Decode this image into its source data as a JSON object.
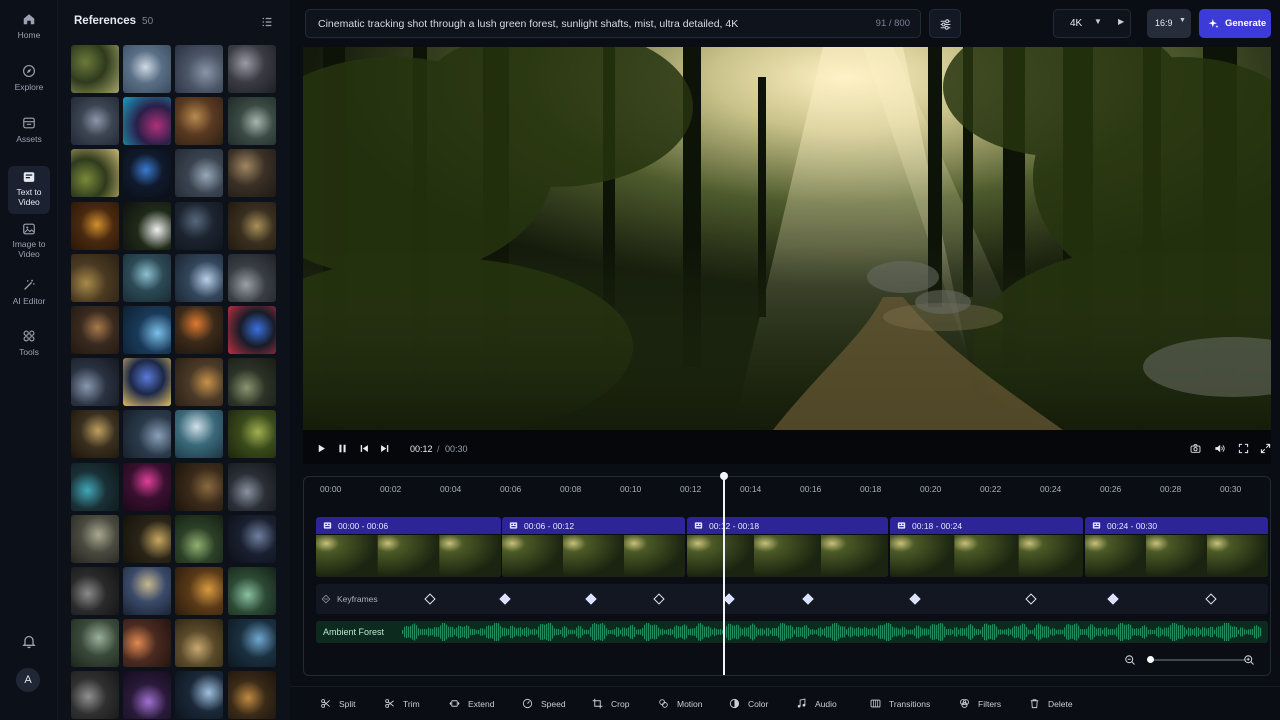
{
  "nav": {
    "items": [
      {
        "label": "Home",
        "icon": "home-icon"
      },
      {
        "label": "Explore",
        "icon": "compass-icon"
      },
      {
        "label": "Assets",
        "icon": "folder-icon"
      },
      {
        "label": "Text to\nVideo",
        "icon": "text-video-icon",
        "active": true
      },
      {
        "label": "Image to\nVideo",
        "icon": "image-video-icon"
      },
      {
        "label": "AI Editor",
        "icon": "magic-wand-icon"
      },
      {
        "label": "Tools",
        "icon": "grid-icon"
      }
    ],
    "bell_icon": "bell-icon",
    "avatar_initial": "A"
  },
  "references": {
    "title": "References",
    "count": "50",
    "list_icon": "list-icon",
    "thumbnail_rows": 13,
    "thumbnail_columns": 4
  },
  "prompt": {
    "text": "Cinematic tracking shot through a lush green forest, sunlight shafts, mist, ultra detailed, 4K",
    "counter": "91 / 800"
  },
  "toolbar_top": {
    "adjust_icon": "sliders-icon",
    "resolution": "4K",
    "aspect_ratio": "16:9",
    "generate_label": "Generate",
    "generate_icon": "sparkle-icon",
    "accent_color": "#3d3bd8"
  },
  "player": {
    "current_time": "00:12",
    "separator": "/",
    "total_time": "00:30",
    "icons": [
      "play-icon",
      "pause-icon",
      "skip-back-icon",
      "skip-forward-icon",
      "camera-icon",
      "volume-icon",
      "fullscreen-icon",
      "expand-icon"
    ]
  },
  "timeline": {
    "ticks": [
      "00:00",
      "00:02",
      "00:04",
      "00:06",
      "00:08",
      "00:10",
      "00:12",
      "00:14",
      "00:16",
      "00:18",
      "00:20",
      "00:22",
      "00:24",
      "00:26",
      "00:28",
      "00:30"
    ],
    "playhead_time": "00:12",
    "clips": [
      {
        "label": "00:00  -  00:06"
      },
      {
        "label": "00:06  -  00:12"
      },
      {
        "label": "00:12  -  00:18"
      },
      {
        "label": "00:18  -  00:24"
      },
      {
        "label": "00:24  -  00:30"
      }
    ],
    "clip_color": "#2d2597",
    "keyframes_label": "Keyframes",
    "keyframes": [
      {
        "filled": false
      },
      {
        "filled": true
      },
      {
        "filled": true
      },
      {
        "filled": false
      },
      {
        "filled": true
      },
      {
        "filled": true
      },
      {
        "filled": true
      },
      {
        "filled": false
      },
      {
        "filled": true
      },
      {
        "filled": false
      }
    ],
    "audio_label": "Ambient Forest",
    "audio_color": "#1f8a5a"
  },
  "tools": [
    {
      "label": "Split",
      "icon": "scissors-icon"
    },
    {
      "label": "Trim",
      "icon": "trim-icon"
    },
    {
      "label": "Extend",
      "icon": "extend-icon"
    },
    {
      "label": "Speed",
      "icon": "speed-icon"
    },
    {
      "label": "Crop",
      "icon": "crop-icon"
    },
    {
      "label": "Motion",
      "icon": "motion-icon"
    },
    {
      "label": "Color",
      "icon": "color-icon"
    },
    {
      "label": "Audio",
      "icon": "music-icon"
    },
    {
      "label": "Transitions",
      "icon": "transitions-icon"
    },
    {
      "label": "Filters",
      "icon": "filters-icon"
    },
    {
      "label": "Delete",
      "icon": "trash-icon"
    }
  ]
}
